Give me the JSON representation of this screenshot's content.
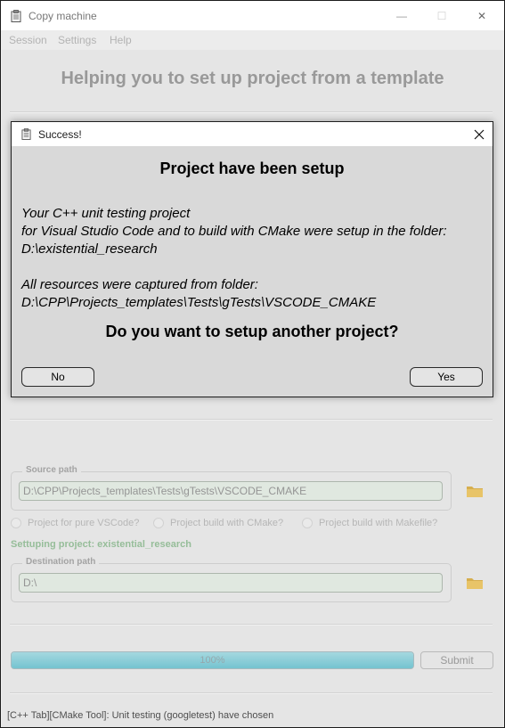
{
  "window": {
    "title": "Copy machine",
    "controls": {
      "minimize": "—",
      "maximize": "☐",
      "close": "✕"
    }
  },
  "menu": {
    "items": [
      "Session",
      "Settings",
      "Help"
    ]
  },
  "main": {
    "heading": "Helping you to set up project from a template",
    "source": {
      "title": "Source path",
      "value": "D:\\CPP\\Projects_templates\\Tests\\gTests\\VSCODE_CMAKE"
    },
    "radios": [
      {
        "label": "Project for pure VSCode?",
        "checked": false
      },
      {
        "label": "Project build with CMake?",
        "checked": false
      },
      {
        "label": "Project build with Makefile?",
        "checked": false
      }
    ],
    "setup_status": "Settuping project: existential_research",
    "destination": {
      "title": "Destination path",
      "value": "D:\\"
    },
    "progress": {
      "percent": 100,
      "text": "100%"
    },
    "submit_label": "Submit"
  },
  "statusbar": {
    "text": "[C++ Tab][CMake Tool]: Unit testing (googletest) have chosen"
  },
  "dialog": {
    "title": "Success!",
    "heading": "Project have been setup",
    "message_lines_1": [
      "Your C++ unit testing project",
      "for Visual Studio Code and to build with CMake were setup in the folder:",
      "D:\\existential_research"
    ],
    "message_lines_2": [
      "All resources were captured from folder:",
      "D:\\CPP\\Projects_templates\\Tests\\gTests\\VSCODE_CMAKE"
    ],
    "question": "Do you want to setup another project?",
    "no_label": "No",
    "yes_label": "Yes"
  },
  "colors": {
    "progress_fill": "#62c3d2",
    "status_green": "#8bbb8f",
    "folder": "#e7b845"
  },
  "icons": {
    "app": "clipboard-icon",
    "source_folder": "folder-icon",
    "destination_folder": "folder-icon",
    "dialog_close": "close-icon"
  }
}
